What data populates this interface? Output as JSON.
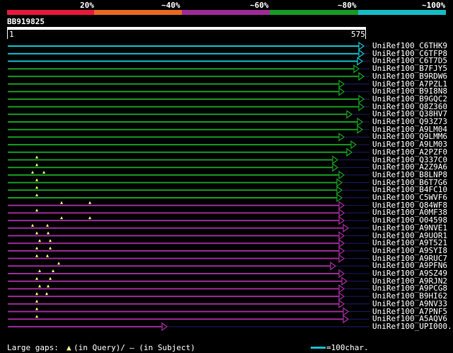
{
  "colors": {
    "red": "#e8183a",
    "orange": "#e66a1f",
    "purple": "#9c2b97",
    "green": "#179a23",
    "cyan": "#17bcc6",
    "thin": "#1c1c6b",
    "background": "#000000"
  },
  "legend": [
    {
      "label": "20%",
      "color": "#e8183a"
    },
    {
      "label": "~40%",
      "color": "#e66a1f"
    },
    {
      "label": "~60%",
      "color": "#9c2b97"
    },
    {
      "label": "~80%",
      "color": "#179a23"
    },
    {
      "label": "~100%",
      "color": "#17bcc6"
    }
  ],
  "query": {
    "id": "BB919825",
    "start": "1",
    "end": "575"
  },
  "hits": [
    {
      "label": "UniRef100_C6THK9",
      "color": "cyan",
      "end": 514,
      "gaps": []
    },
    {
      "label": "UniRef100_C6TFP8",
      "color": "cyan",
      "end": 514,
      "gaps": []
    },
    {
      "label": "UniRef100_C6T7D5",
      "color": "cyan",
      "end": 512,
      "gaps": []
    },
    {
      "label": "UniRef100_B7FJY5",
      "color": "green",
      "end": 507,
      "gaps": []
    },
    {
      "label": "UniRef100_B9RDW6",
      "color": "green",
      "end": 514,
      "gaps": []
    },
    {
      "label": "UniRef100_A7PZL1",
      "color": "green",
      "end": 486,
      "gaps": []
    },
    {
      "label": "UniRef100_B9I8N8",
      "color": "green",
      "end": 486,
      "gaps": []
    },
    {
      "label": "UniRef100_B9GQC2",
      "color": "green",
      "end": 514,
      "gaps": []
    },
    {
      "label": "UniRef100_Q8Z360",
      "color": "green",
      "end": 514,
      "gaps": []
    },
    {
      "label": "UniRef100_Q38HV7",
      "color": "green",
      "end": 497,
      "gaps": []
    },
    {
      "label": "UniRef100_Q93Z73",
      "color": "green",
      "end": 512,
      "gaps": []
    },
    {
      "label": "UniRef100_A9LM04",
      "color": "green",
      "end": 512,
      "gaps": []
    },
    {
      "label": "UniRef100_Q9LMM6",
      "color": "green",
      "end": 486,
      "gaps": []
    },
    {
      "label": "UniRef100_A9LM03",
      "color": "green",
      "end": 503,
      "gaps": []
    },
    {
      "label": "UniRef100_A2PZF0",
      "color": "green",
      "end": 497,
      "gaps": []
    },
    {
      "label": "UniRef100_Q337C0",
      "color": "green",
      "end": 477,
      "gaps": [
        52
      ]
    },
    {
      "label": "UniRef100_A2Z9A6",
      "color": "green",
      "end": 477,
      "gaps": [
        52
      ]
    },
    {
      "label": "UniRef100_B8LNP8",
      "color": "green",
      "end": 486,
      "gaps": [
        46,
        62
      ]
    },
    {
      "label": "UniRef100_B6T7G6",
      "color": "green",
      "end": 483,
      "gaps": [
        52
      ]
    },
    {
      "label": "UniRef100_B4FC10",
      "color": "green",
      "end": 483,
      "gaps": [
        52
      ]
    },
    {
      "label": "UniRef100_C5WVF6",
      "color": "green",
      "end": 483,
      "gaps": [
        52
      ]
    },
    {
      "label": "UniRef100_Q84WF8",
      "color": "purple",
      "end": 486,
      "gaps": [
        87,
        127
      ]
    },
    {
      "label": "UniRef100_A0MF38",
      "color": "purple",
      "end": 486,
      "gaps": [
        52
      ]
    },
    {
      "label": "UniRef100_O04598",
      "color": "purple",
      "end": 486,
      "gaps": [
        87,
        127
      ]
    },
    {
      "label": "UniRef100_A9NVE1",
      "color": "purple",
      "end": 492,
      "gaps": [
        46,
        67
      ]
    },
    {
      "label": "UniRef100_A9UOR1",
      "color": "purple",
      "end": 486,
      "gaps": [
        52,
        68
      ]
    },
    {
      "label": "UniRef100_A9T521",
      "color": "purple",
      "end": 486,
      "gaps": [
        56,
        71
      ]
    },
    {
      "label": "UniRef100_A9SYI8",
      "color": "purple",
      "end": 486,
      "gaps": [
        52,
        71
      ]
    },
    {
      "label": "UniRef100_A9RUC7",
      "color": "purple",
      "end": 486,
      "gaps": [
        52,
        67
      ]
    },
    {
      "label": "UniRef100_A9PFN6",
      "color": "purple",
      "end": 474,
      "gaps": [
        83
      ]
    },
    {
      "label": "UniRef100_A9SZ49",
      "color": "purple",
      "end": 486,
      "gaps": [
        56,
        75
      ]
    },
    {
      "label": "UniRef100_A9RJN2",
      "color": "purple",
      "end": 490,
      "gaps": [
        52,
        71
      ]
    },
    {
      "label": "UniRef100_A9PCG8",
      "color": "purple",
      "end": 486,
      "gaps": [
        56,
        68
      ]
    },
    {
      "label": "UniRef100_B9HI62",
      "color": "purple",
      "end": 486,
      "gaps": [
        52,
        66
      ]
    },
    {
      "label": "UniRef100_A9NV33",
      "color": "purple",
      "end": 486,
      "gaps": [
        52
      ]
    },
    {
      "label": "UniRef100_A7PNF5",
      "color": "purple",
      "end": 492,
      "gaps": [
        52
      ]
    },
    {
      "label": "UniRef100_A5AQV6",
      "color": "purple",
      "end": 492,
      "gaps": [
        52
      ]
    },
    {
      "label": "UniRef100_UPI000...",
      "color": "purple",
      "end": 236,
      "gaps": []
    }
  ],
  "footer": {
    "gaps_prefix": "Large gaps: ",
    "gaps_query": "(in Query)/",
    "gaps_subject": "— (in Subject)",
    "scale_text": "=100char."
  }
}
